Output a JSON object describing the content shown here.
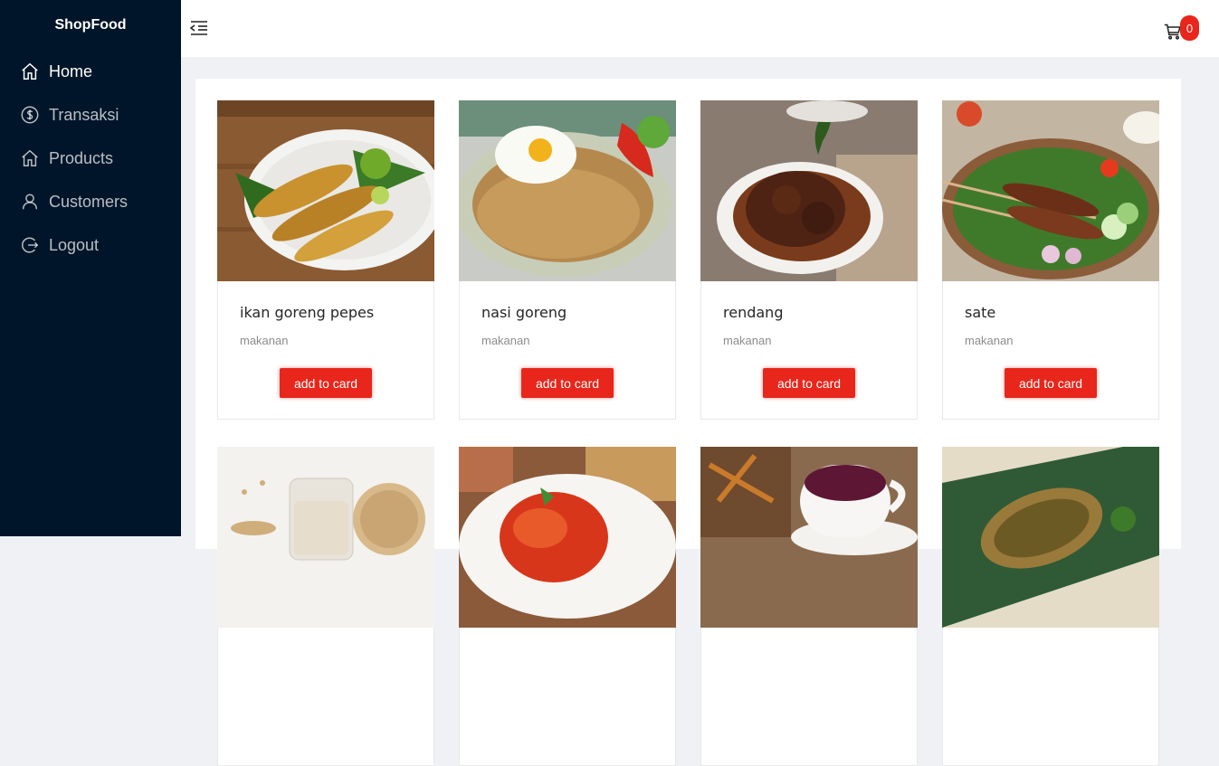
{
  "sidebar": {
    "brand": "ShopFood",
    "items": [
      {
        "label": "Home",
        "icon": "home-icon",
        "active": true
      },
      {
        "label": "Transaksi",
        "icon": "dollar-circle-icon",
        "active": false
      },
      {
        "label": "Products",
        "icon": "home-icon",
        "active": false
      },
      {
        "label": "Customers",
        "icon": "user-icon",
        "active": false
      },
      {
        "label": "Logout",
        "icon": "logout-icon",
        "active": false
      }
    ]
  },
  "header": {
    "collapse_icon": "menu-fold-icon",
    "cart_icon": "shopping-cart-icon",
    "cart_count": "0"
  },
  "products": [
    {
      "name": "ikan goreng pepes",
      "category": "makanan",
      "button": "add to card",
      "image": "fried fish"
    },
    {
      "name": "nasi goreng",
      "category": "makanan",
      "button": "add to card",
      "image": "fried rice with egg"
    },
    {
      "name": "rendang",
      "category": "makanan",
      "button": "add to card",
      "image": "beef rendang"
    },
    {
      "name": "sate",
      "category": "makanan",
      "button": "add to card",
      "image": "satay skewers"
    },
    {
      "name": "",
      "category": "",
      "button": "",
      "image": "soy milk"
    },
    {
      "name": "",
      "category": "",
      "button": "",
      "image": "balado dish"
    },
    {
      "name": "",
      "category": "",
      "button": "",
      "image": "herbal tea"
    },
    {
      "name": "",
      "category": "",
      "button": "",
      "image": "grilled fish on leaf"
    }
  ],
  "colors": {
    "sidebar_bg": "#001529",
    "accent_red": "#e8261b",
    "page_bg": "#f0f1f5"
  }
}
